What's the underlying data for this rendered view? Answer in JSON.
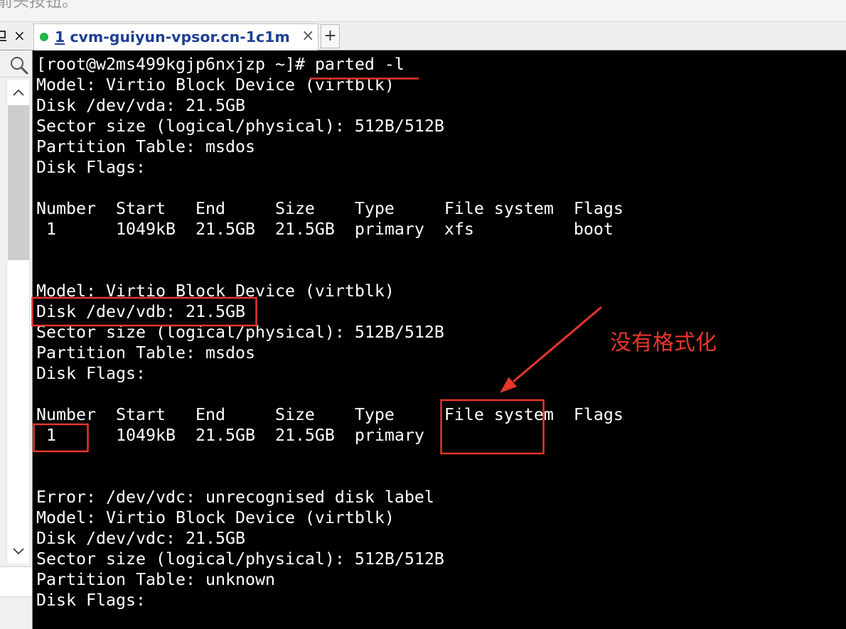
{
  "window": {
    "top_hint": "箭头按钮。"
  },
  "tabbar": {
    "left_close": "×",
    "tab": {
      "number": "1",
      "title": "cvm-guiyun-vpsor.cn-1c1m",
      "close": "×",
      "status_color": "#22b24c",
      "title_color": "#1d3f93"
    },
    "new_tab": "+"
  },
  "sidebar": {
    "icons": {
      "pin": "pin-icon",
      "search": "search-icon",
      "scroll_up": "chevron-up-icon",
      "scroll_down": "chevron-down-icon"
    }
  },
  "terminal": {
    "background": "#000000",
    "foreground": "#ffffff",
    "prompt": "[root@w2ms499kgjp6nxjzp ~]# ",
    "command": "parted -l",
    "output": [
      "Model: Virtio Block Device (virtblk)",
      "Disk /dev/vda: 21.5GB",
      "Sector size (logical/physical): 512B/512B",
      "Partition Table: msdos",
      "Disk Flags:",
      "",
      "Number  Start   End     Size    Type     File system  Flags",
      " 1      1049kB  21.5GB  21.5GB  primary  xfs          boot",
      "",
      "",
      "Model: Virtio Block Device (virtblk)",
      "Disk /dev/vdb: 21.5GB",
      "Sector size (logical/physical): 512B/512B",
      "Partition Table: msdos",
      "Disk Flags:",
      "",
      "Number  Start   End     Size    Type     File system  Flags",
      " 1      1049kB  21.5GB  21.5GB  primary",
      "",
      "",
      "Error: /dev/vdc: unrecognised disk label",
      "Model: Virtio Block Device (virtblk)",
      "Disk /dev/vdc: 21.5GB",
      "Sector size (logical/physical): 512B/512B",
      "Partition Table: unknown",
      "Disk Flags:"
    ]
  },
  "annotation": {
    "note": "没有格式化",
    "color": "#e8362c"
  }
}
